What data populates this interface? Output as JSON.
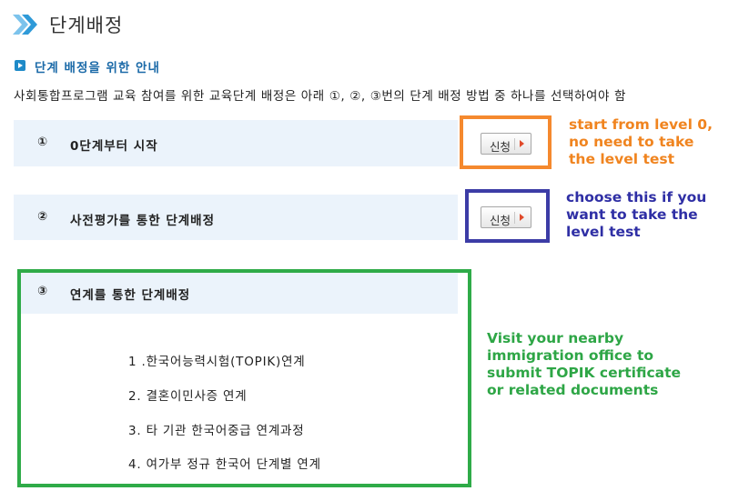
{
  "header": {
    "title": "단계배정"
  },
  "section": {
    "title": "단계 배정을 위한 안내",
    "intro": "사회통합프로그램 교육 참여를 위한 교육단계 배정은 아래 ①, ②, ③번의 단계 배정 방법 중 하나를 선택하여야 함"
  },
  "options": [
    {
      "number": "①",
      "label": "0단계부터 시작",
      "button": "신청"
    },
    {
      "number": "②",
      "label": "사전평가를 통한 단계배정",
      "button": "신청"
    },
    {
      "number": "③",
      "label": "연계를 통한 단계배정"
    }
  ],
  "linkage_list": [
    "1 .한국어능력시험(TOPIK)연계",
    "2. 결혼이민사증 연계",
    "3. 타 기관 한국어중급 연계과정",
    "4. 여가부 정규 한국어 단계별 연계"
  ],
  "annotations": {
    "orange": "start from level 0,\nno need to take\nthe level test",
    "blue": "choose this if you\nwant to take the\nlevel test",
    "green": "Visit your nearby\nimmigration office to\nsubmit TOPIK certificate\nor related documents"
  },
  "colors": {
    "accent_blue": "#1e8ac8",
    "row_bg": "#ebf3fb",
    "orange": "#f5892e",
    "indigo": "#3c3ca6",
    "green": "#2fab48"
  },
  "icons": {
    "title": "double-chevron-right-icon",
    "section": "play-square-icon",
    "button": "arrow-right-icon"
  }
}
